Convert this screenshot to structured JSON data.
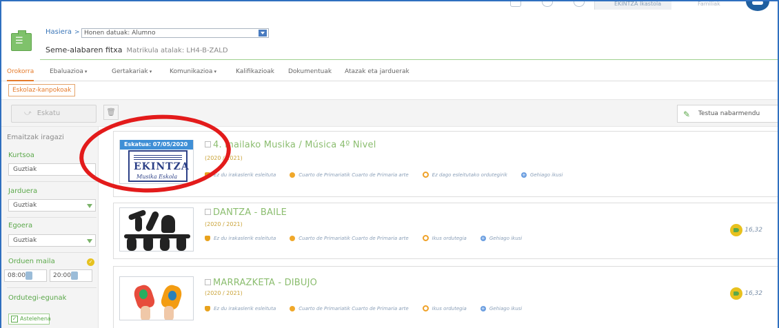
{
  "topbar": {
    "school": "EKINTZA Ikastola",
    "family": "Familiak"
  },
  "header": {
    "home": "Hasiera",
    "separator": ">",
    "select_value": "Honen datuak: Alumno",
    "title": "Seme-alabaren fitxa",
    "subtitle": "Matrikula atalak: LH4-B-ZALD"
  },
  "tabs": [
    {
      "label": "Orokorra",
      "caret": ""
    },
    {
      "label": "Ebaluazioa",
      "caret": "▾"
    },
    {
      "label": "Gertakariak",
      "caret": "▾"
    },
    {
      "label": "Komunikazioa",
      "caret": "▾"
    },
    {
      "label": "Kalifikazioak",
      "caret": ""
    },
    {
      "label": "Dokumentuak",
      "caret": ""
    },
    {
      "label": "Atazak eta jarduerak",
      "caret": ""
    }
  ],
  "subtab": "Eskolaz-kanpokoak",
  "actions": {
    "ask": "Eskatu",
    "highlight": "Testua nabarmendu"
  },
  "filters": {
    "title": "Emaitzak iragazi",
    "course_label": "Kurtsoa",
    "course_value": "Guztiak",
    "activity_label": "Jarduera",
    "activity_value": "Guztiak",
    "status_label": "Egoera",
    "status_value": "Guztiak",
    "time_label": "Orduen maila",
    "time_from": "08:00",
    "time_to": "20:00",
    "days_label": "Ordutegi-egunak",
    "day_monday": "Astelehena"
  },
  "activities": [
    {
      "ribbon": "Eskatua: 07/05/2020",
      "title": "4. mailako Musika / Música 4º Nivel",
      "year": "(2020 / 2021)",
      "teacher": "Ez du irakaslerik esleituta",
      "range": "Cuarto de Primariatik Cuarto de Primaria arte",
      "schedule": "Ez dago esleitutako ordutegirik",
      "more": "Gehiago ikusi",
      "price": "",
      "logo_text": "EKINTZA",
      "logo_sub": "Musika Eskola"
    },
    {
      "ribbon": "",
      "title": "DANTZA - BAILE",
      "year": "(2020 / 2021)",
      "teacher": "Ez du irakaslerik esleituta",
      "range": "Cuarto de Primariatik Cuarto de Primaria arte",
      "schedule": "Ikus ordutegia",
      "more": "Gehiago ikusi",
      "price": "16,32"
    },
    {
      "ribbon": "",
      "title": "MARRAZKETA - DIBUJO",
      "year": "(2020 / 2021)",
      "teacher": "Ez du irakaslerik esleituta",
      "range": "Cuarto de Primariatik Cuarto de Primaria arte",
      "schedule": "Ikus ordutegia",
      "more": "Gehiago ikusi",
      "price": "16,32"
    }
  ],
  "colors": {
    "accent_orange": "#e57a2a",
    "accent_green": "#5ba84a",
    "title_green": "#8bbd6f",
    "ribbon_blue": "#3f8fd6",
    "annotation_red": "#e31b1b"
  }
}
